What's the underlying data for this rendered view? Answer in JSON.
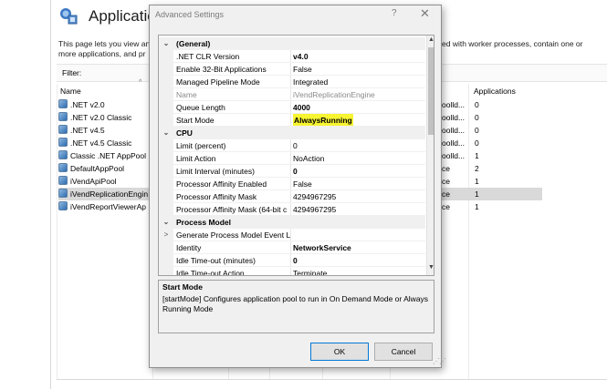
{
  "background": {
    "title": "Applicatio",
    "description_left": [
      "This page lets you view an",
      "more applications, and pr"
    ],
    "description_right": [
      "ed with worker processes, contain one or",
      ""
    ],
    "filter_label": "Filter:",
    "columns": {
      "name": "Name",
      "applications": "Applications"
    },
    "pools": [
      {
        "name": ".NET v2.0",
        "pipe": "oolld...",
        "apps": "0"
      },
      {
        "name": ".NET v2.0 Classic",
        "pipe": "oolld...",
        "apps": "0"
      },
      {
        "name": ".NET v4.5",
        "pipe": "oolld...",
        "apps": "0"
      },
      {
        "name": ".NET v4.5 Classic",
        "pipe": "oolld...",
        "apps": "0"
      },
      {
        "name": "Classic .NET AppPool",
        "pipe": "oolld...",
        "apps": "1"
      },
      {
        "name": "DefaultAppPool",
        "pipe": "ce",
        "apps": "2"
      },
      {
        "name": "iVendApiPool",
        "pipe": "ce",
        "apps": "1"
      },
      {
        "name": "iVendReplicationEngin",
        "pipe": "ce",
        "apps": "1"
      },
      {
        "name": "iVendReportViewerAp",
        "pipe": "ce",
        "apps": "1"
      }
    ]
  },
  "dialog": {
    "title": "Advanced Settings",
    "help": "?",
    "close": "✕",
    "rows": [
      {
        "type": "cat",
        "label": "(General)",
        "toggle": "⌄"
      },
      {
        "type": "prop",
        "name": ".NET CLR Version",
        "value": "v4.0",
        "style": "bold"
      },
      {
        "type": "prop",
        "name": "Enable 32-Bit Applications",
        "value": "False",
        "style": ""
      },
      {
        "type": "prop",
        "name": "Managed Pipeline Mode",
        "value": "Integrated",
        "style": ""
      },
      {
        "type": "prop",
        "name": "Name",
        "value": "iVendReplicationEngine",
        "style": "disabled"
      },
      {
        "type": "prop",
        "name": "Queue Length",
        "value": "4000",
        "style": "bold"
      },
      {
        "type": "prop",
        "name": "Start Mode",
        "value": "AlwaysRunning",
        "style": "hl"
      },
      {
        "type": "cat",
        "label": "CPU",
        "toggle": "⌄"
      },
      {
        "type": "prop",
        "name": "Limit (percent)",
        "value": "0",
        "style": ""
      },
      {
        "type": "prop",
        "name": "Limit Action",
        "value": "NoAction",
        "style": ""
      },
      {
        "type": "prop",
        "name": "Limit Interval (minutes)",
        "value": "0",
        "style": "bold"
      },
      {
        "type": "prop",
        "name": "Processor Affinity Enabled",
        "value": "False",
        "style": ""
      },
      {
        "type": "prop",
        "name": "Processor Affinity Mask",
        "value": "4294967295",
        "style": ""
      },
      {
        "type": "prop",
        "name": "Processor Affinity Mask (64-bit c",
        "value": "4294967295",
        "style": ""
      },
      {
        "type": "cat",
        "label": "Process Model",
        "toggle": "⌄"
      },
      {
        "type": "prop",
        "name": "Generate Process Model Event L",
        "value": "",
        "style": "",
        "expand": ">"
      },
      {
        "type": "prop",
        "name": "Identity",
        "value": "NetworkService",
        "style": "bold"
      },
      {
        "type": "prop",
        "name": "Idle Time-out (minutes)",
        "value": "0",
        "style": "bold"
      },
      {
        "type": "prop",
        "name": "Idle Time-out Action",
        "value": "Terminate",
        "style": ""
      }
    ],
    "description": {
      "title": "Start Mode",
      "text": "[startMode] Configures application pool to run in On Demand Mode or Always Running Mode"
    },
    "ok_label": "OK",
    "cancel_label": "Cancel"
  }
}
